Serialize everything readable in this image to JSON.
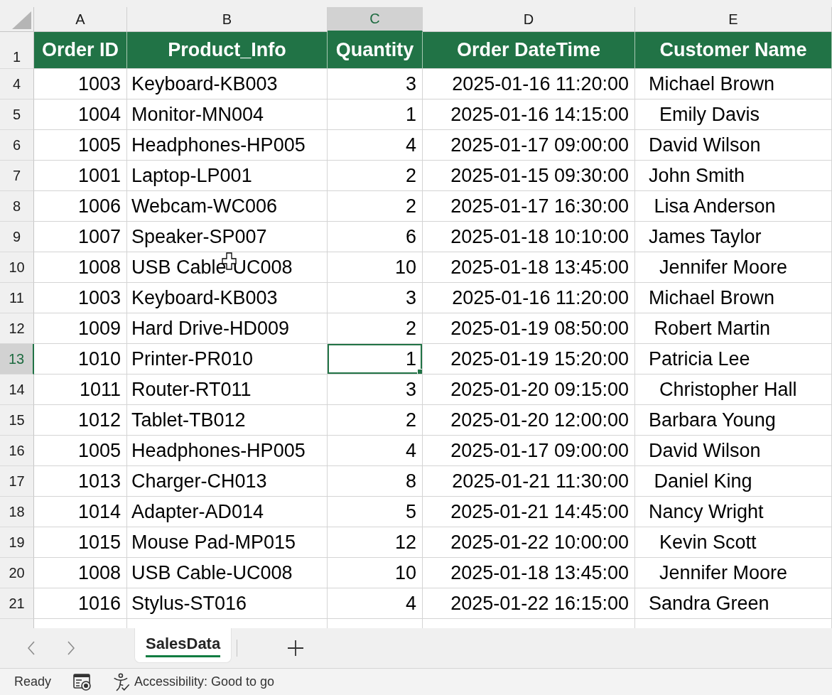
{
  "columns": [
    {
      "letter": "A",
      "selected": false
    },
    {
      "letter": "B",
      "selected": false
    },
    {
      "letter": "C",
      "selected": true
    },
    {
      "letter": "D",
      "selected": false
    },
    {
      "letter": "E",
      "selected": false
    }
  ],
  "header_row": {
    "number": "1",
    "cells": [
      "Order ID",
      "Product_Info",
      "Quantity",
      "Order DateTime",
      "Customer Name"
    ]
  },
  "rows": [
    {
      "number": "4",
      "selected": false,
      "hovered": false,
      "cells": [
        "1003",
        "Keyboard-KB003",
        "3",
        "2025-01-16 11:20:00",
        "  Michael Brown"
      ]
    },
    {
      "number": "5",
      "selected": false,
      "hovered": false,
      "cells": [
        "1004",
        "Monitor-MN004",
        "1",
        "2025-01-16 14:15:00",
        "    Emily Davis"
      ]
    },
    {
      "number": "6",
      "selected": false,
      "hovered": false,
      "cells": [
        "1005",
        "Headphones-HP005",
        "4",
        "2025-01-17 09:00:00",
        "  David Wilson"
      ]
    },
    {
      "number": "7",
      "selected": false,
      "hovered": false,
      "cells": [
        "1001",
        "Laptop-LP001",
        "2",
        "2025-01-15 09:30:00",
        "  John Smith"
      ]
    },
    {
      "number": "8",
      "selected": false,
      "hovered": false,
      "cells": [
        "1006",
        "Webcam-WC006",
        "2",
        "2025-01-17 16:30:00",
        "   Lisa Anderson"
      ]
    },
    {
      "number": "9",
      "selected": false,
      "hovered": false,
      "cells": [
        "1007",
        "Speaker-SP007",
        "6",
        "2025-01-18 10:10:00",
        "  James Taylor"
      ]
    },
    {
      "number": "10",
      "selected": false,
      "hovered": true,
      "cells": [
        "1008",
        "USB Cable-UC008",
        "10",
        "2025-01-18 13:45:00",
        "    Jennifer Moore"
      ]
    },
    {
      "number": "11",
      "selected": false,
      "hovered": false,
      "cells": [
        "1003",
        "Keyboard-KB003",
        "3",
        "2025-01-16 11:20:00",
        "  Michael Brown"
      ]
    },
    {
      "number": "12",
      "selected": false,
      "hovered": false,
      "cells": [
        "1009",
        "Hard Drive-HD009",
        "2",
        "2025-01-19 08:50:00",
        "   Robert Martin"
      ]
    },
    {
      "number": "13",
      "selected": true,
      "hovered": false,
      "cells": [
        "1010",
        "Printer-PR010",
        "1",
        "2025-01-19 15:20:00",
        "  Patricia Lee"
      ]
    },
    {
      "number": "14",
      "selected": false,
      "hovered": false,
      "cells": [
        "1011",
        "Router-RT011",
        "3",
        "2025-01-20 09:15:00",
        "    Christopher Hall"
      ]
    },
    {
      "number": "15",
      "selected": false,
      "hovered": false,
      "cells": [
        "1012",
        "Tablet-TB012",
        "2",
        "2025-01-20 12:00:00",
        "  Barbara Young"
      ]
    },
    {
      "number": "16",
      "selected": false,
      "hovered": false,
      "cells": [
        "1005",
        "Headphones-HP005",
        "4",
        "2025-01-17 09:00:00",
        "  David Wilson"
      ]
    },
    {
      "number": "17",
      "selected": false,
      "hovered": false,
      "cells": [
        "1013",
        "Charger-CH013",
        "8",
        "2025-01-21 11:30:00",
        "   Daniel King"
      ]
    },
    {
      "number": "18",
      "selected": false,
      "hovered": false,
      "cells": [
        "1014",
        "Adapter-AD014",
        "5",
        "2025-01-21 14:45:00",
        "  Nancy Wright"
      ]
    },
    {
      "number": "19",
      "selected": false,
      "hovered": false,
      "cells": [
        "1015",
        "Mouse Pad-MP015",
        "12",
        "2025-01-22 10:00:00",
        "    Kevin Scott"
      ]
    },
    {
      "number": "20",
      "selected": false,
      "hovered": false,
      "cells": [
        "1008",
        "USB Cable-UC008",
        "10",
        "2025-01-18 13:45:00",
        "    Jennifer Moore"
      ]
    },
    {
      "number": "21",
      "selected": false,
      "hovered": false,
      "cells": [
        "1016",
        "Stylus-ST016",
        "4",
        "2025-01-22 16:15:00",
        "  Sandra Green"
      ]
    }
  ],
  "sheet_tabs": [
    {
      "label": "SalesData",
      "selected": true
    }
  ],
  "status_bar": {
    "mode": "Ready",
    "accessibility": "Accessibility: Good to go"
  }
}
